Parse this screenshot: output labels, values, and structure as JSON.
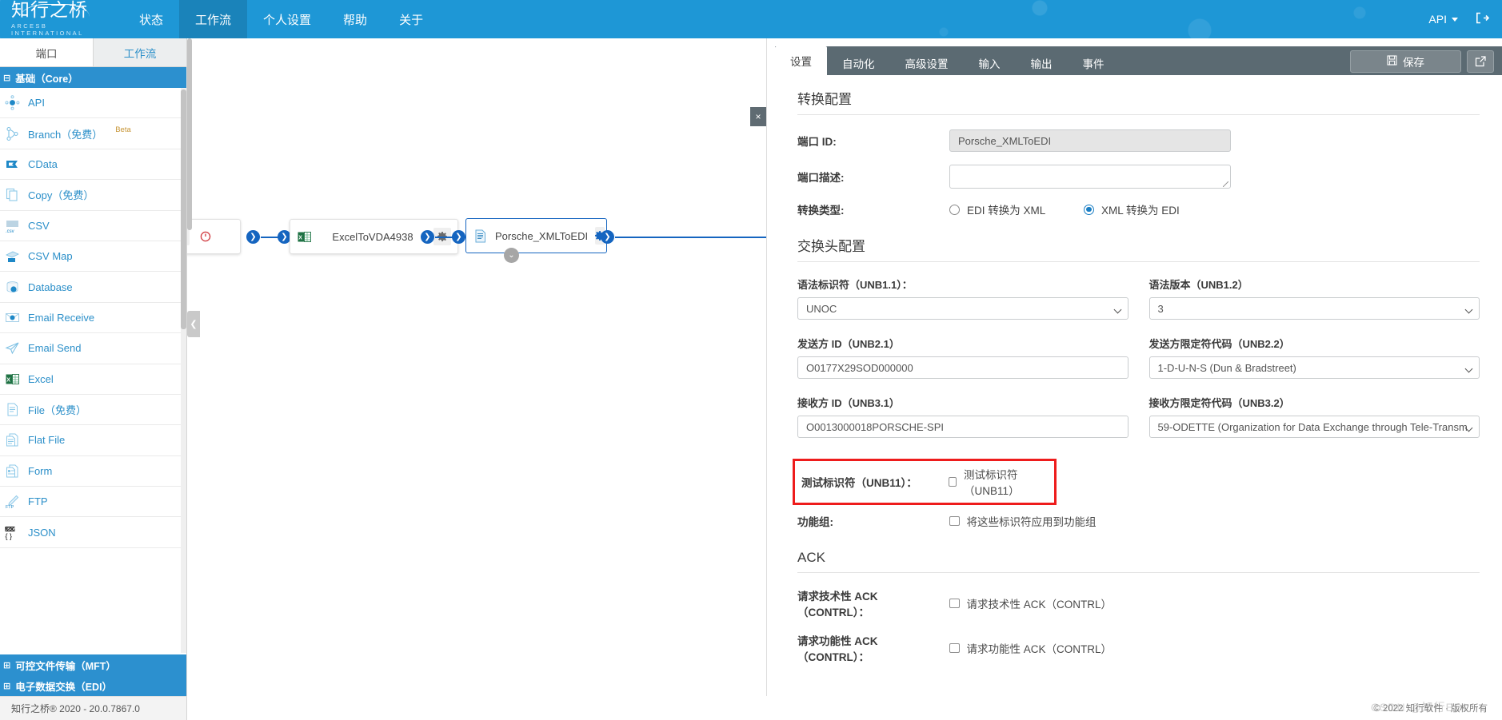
{
  "header": {
    "logo_text": "知行之桥",
    "logo_sub": "ARCESB INTERNATIONAL",
    "nav": [
      {
        "label": "状态",
        "active": false
      },
      {
        "label": "工作流",
        "active": true
      },
      {
        "label": "个人设置",
        "active": false
      },
      {
        "label": "帮助",
        "active": false
      },
      {
        "label": "关于",
        "active": false
      }
    ],
    "api_label": "API",
    "logout_icon": "logout-icon"
  },
  "sidebar": {
    "tabs": [
      {
        "label": "端口",
        "active": true
      },
      {
        "label": "工作流",
        "active": false
      }
    ],
    "group_core": "基础（Core）",
    "items": [
      {
        "label": "API",
        "icon": "api-icon",
        "badge": ""
      },
      {
        "label": "Branch（免费）",
        "icon": "branch-icon",
        "badge": "Beta"
      },
      {
        "label": "CData",
        "icon": "cdata-icon",
        "badge": ""
      },
      {
        "label": "Copy（免费）",
        "icon": "copy-icon",
        "badge": ""
      },
      {
        "label": "CSV",
        "icon": "csv-icon",
        "badge": ""
      },
      {
        "label": "CSV Map",
        "icon": "csv-map-icon",
        "badge": ""
      },
      {
        "label": "Database",
        "icon": "database-icon",
        "badge": ""
      },
      {
        "label": "Email Receive",
        "icon": "email-receive-icon",
        "badge": ""
      },
      {
        "label": "Email Send",
        "icon": "email-send-icon",
        "badge": ""
      },
      {
        "label": "Excel",
        "icon": "excel-icon",
        "badge": ""
      },
      {
        "label": "File（免费）",
        "icon": "file-icon",
        "badge": ""
      },
      {
        "label": "Flat File",
        "icon": "flat-file-icon",
        "badge": ""
      },
      {
        "label": "Form",
        "icon": "form-icon",
        "badge": ""
      },
      {
        "label": "FTP",
        "icon": "ftp-icon",
        "badge": ""
      },
      {
        "label": "JSON",
        "icon": "json-icon",
        "badge": ""
      }
    ],
    "group_mft": "可控文件传输（MFT）",
    "group_edi": "电子数据交换（EDI）"
  },
  "canvas": {
    "nodes": [
      {
        "name": "ExcelToVDA4938",
        "icon": "excel-file-icon",
        "selected": false
      },
      {
        "name": "Porsche_XMLToEDI",
        "icon": "xml-file-icon",
        "selected": true
      }
    ]
  },
  "panel": {
    "tabs": [
      {
        "label": "设置",
        "active": true
      },
      {
        "label": "自动化",
        "active": false
      },
      {
        "label": "高级设置",
        "active": false
      },
      {
        "label": "输入",
        "active": false
      },
      {
        "label": "输出",
        "active": false
      },
      {
        "label": "事件",
        "active": false
      }
    ],
    "save_label": "保存",
    "close_label": "×",
    "sections": {
      "convert": {
        "title": "转换配置",
        "port_id_label": "端口 ID:",
        "port_id_value": "Porsche_XMLToEDI",
        "port_desc_label": "端口描述:",
        "port_desc_value": "",
        "convert_type_label": "转换类型:",
        "radio_edi_to_xml": "EDI 转换为 XML",
        "radio_xml_to_edi": "XML 转换为 EDI",
        "selected_radio": "XML 转换为 EDI"
      },
      "interchange": {
        "title": "交换头配置",
        "syntax_id_label": "语法标识符（UNB1.1）：",
        "syntax_id_value": "UNOC",
        "syntax_ver_label": "语法版本（UNB1.2）",
        "syntax_ver_value": "3",
        "sender_id_label": "发送方 ID（UNB2.1）",
        "sender_id_value": "O0177X29SOD000000",
        "sender_qual_label": "发送方限定符代码（UNB2.2）",
        "sender_qual_value": "1-D-U-N-S (Dun & Bradstreet)",
        "receiver_id_label": "接收方 ID（UNB3.1）",
        "receiver_id_value": "O0013000018PORSCHE-SPI",
        "receiver_qual_label": "接收方限定符代码（UNB3.2）",
        "receiver_qual_value": "59-ODETTE (Organization for Data Exchange through Tele-Transm",
        "test_indicator_label": "测试标识符（UNB11）：",
        "test_indicator_checkbox": "测试标识符（UNB11）",
        "test_indicator_checked": false,
        "functional_group_label": "功能组:",
        "functional_group_checkbox": "将这些标识符应用到功能组",
        "functional_group_checked": false
      },
      "ack": {
        "title": "ACK",
        "tech_ack_label": "请求技术性 ACK（CONTRL）：",
        "tech_ack_checkbox": "请求技术性 ACK（CONTRL）",
        "tech_ack_checked": false,
        "func_ack_label": "请求功能性 ACK（CONTRL）：",
        "func_ack_checkbox": "请求功能性 ACK（CONTRL）",
        "func_ack_checked": false
      }
    }
  },
  "footer": {
    "version": "知行之桥® 2020 - 20.0.7867.0",
    "copyright": "© 2022 知行软件 · 版权所有",
    "watermark": "CSDN @知行EDI"
  },
  "colors": {
    "brand_blue": "#1e97d6",
    "sidebar_link": "#2b8fc9",
    "panel_dark": "#5b6a72",
    "highlight_red": "#ee1c1c",
    "flow_blue": "#1565c0"
  }
}
